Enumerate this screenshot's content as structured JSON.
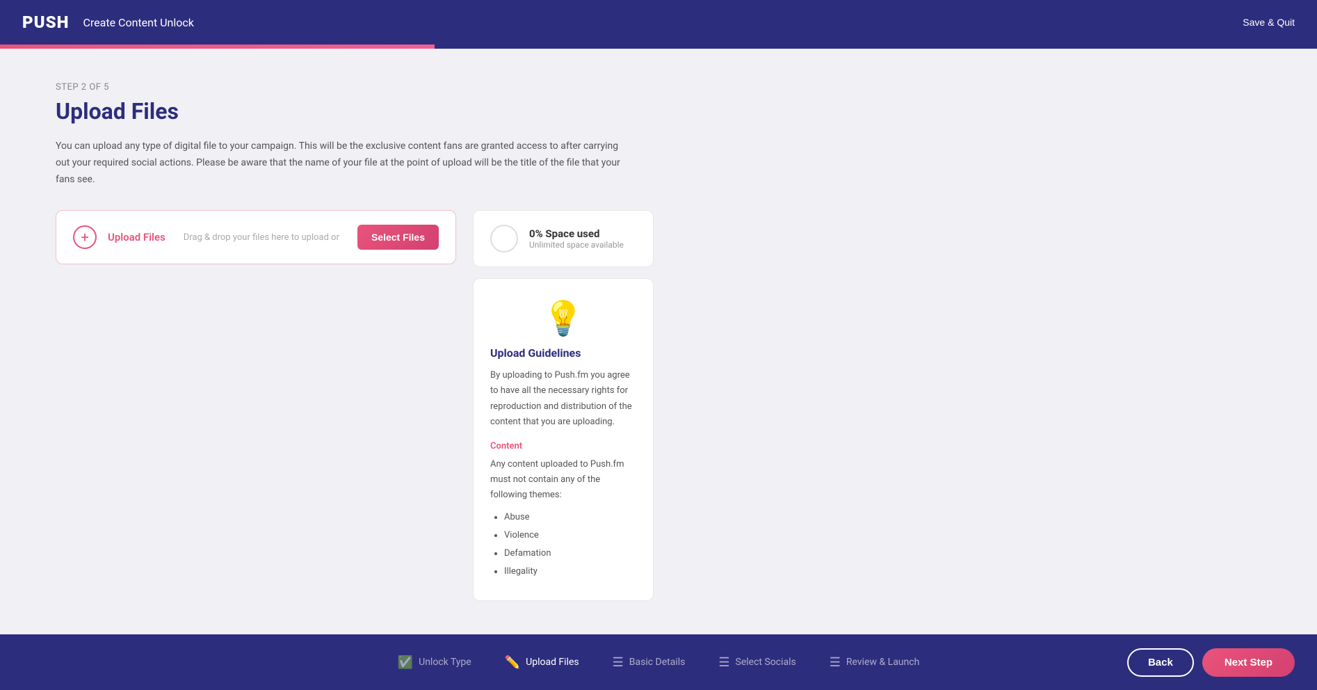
{
  "header": {
    "logo": "PUSH",
    "title": "Create Content Unlock",
    "save_quit_label": "Save & Quit"
  },
  "progress": {
    "fill_percent": "33%"
  },
  "page": {
    "step_label": "STEP 2 OF 5",
    "title": "Upload Files",
    "description_part1": "You can upload any type of digital file to your campaign. This will be the exclusive content fans are granted access to after carrying out your required social actions. Please be aware that the name of your file at the point of upload will be the title of the file that your fans see."
  },
  "upload_card": {
    "label": "Upload Files",
    "drag_text": "Drag & drop your files here to upload or",
    "select_btn": "Select Files"
  },
  "space_card": {
    "percent": "0% Space used",
    "subtitle": "Unlimited space available"
  },
  "guidelines": {
    "title": "Upload Guidelines",
    "body": "By uploading to Push.fm you agree to have all the necessary rights for reproduction and distribution of the content that you are uploading.",
    "section_title": "Content",
    "section_body": "Any content uploaded to Push.fm must not contain any of the following themes:",
    "items": [
      "Abuse",
      "Violence",
      "Defamation",
      "Illegality"
    ]
  },
  "footer": {
    "steps": [
      {
        "id": "unlock-type",
        "label": "Unlock Type",
        "icon": "✅",
        "active": false
      },
      {
        "id": "upload-files",
        "label": "Upload Files",
        "icon": "✏️",
        "active": true
      },
      {
        "id": "basic-details",
        "label": "Basic Details",
        "icon": "📋",
        "active": false
      },
      {
        "id": "select-socials",
        "label": "Select Socials",
        "icon": "📋",
        "active": false
      },
      {
        "id": "review-launch",
        "label": "Review & Launch",
        "icon": "📋",
        "active": false
      }
    ],
    "back_label": "Back",
    "next_label": "Next Step"
  }
}
